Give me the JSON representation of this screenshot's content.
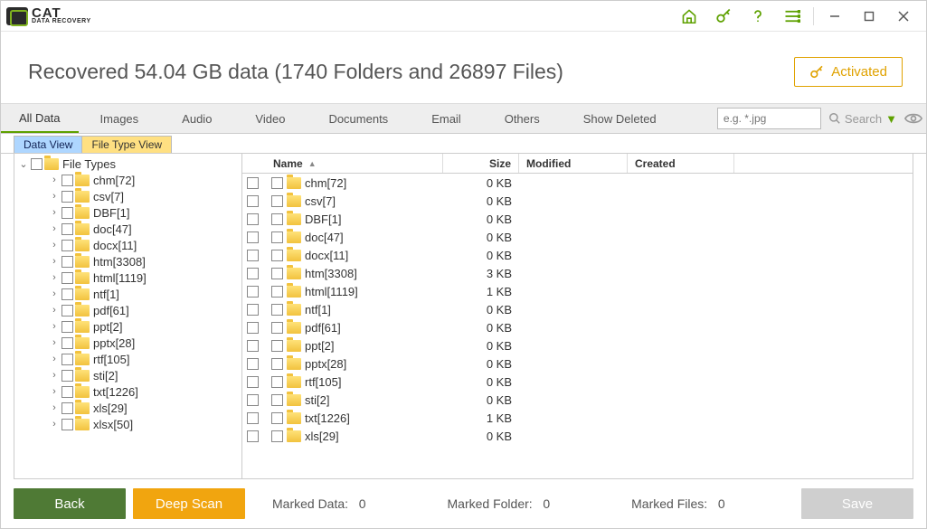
{
  "app": {
    "logo_cat": "CAT",
    "logo_dr": "DATA\nRECOVERY"
  },
  "header": {
    "title": "Recovered 54.04 GB data (1740 Folders and 26897 Files)",
    "activated": "Activated"
  },
  "toolbar": {
    "items": [
      "All Data",
      "Images",
      "Audio",
      "Video",
      "Documents",
      "Email",
      "Others",
      "Show Deleted"
    ],
    "search_placeholder": "e.g. *.jpg",
    "search_label": "Search"
  },
  "view_tabs": {
    "data_view": "Data View",
    "file_type_view": "File Type View"
  },
  "tree": {
    "root": "File Types",
    "items": [
      "chm[72]",
      "csv[7]",
      "DBF[1]",
      "doc[47]",
      "docx[11]",
      "htm[3308]",
      "html[1119]",
      "ntf[1]",
      "pdf[61]",
      "ppt[2]",
      "pptx[28]",
      "rtf[105]",
      "sti[2]",
      "txt[1226]",
      "xls[29]",
      "xlsx[50]"
    ]
  },
  "list": {
    "headers": {
      "name": "Name",
      "size": "Size",
      "modified": "Modified",
      "created": "Created"
    },
    "rows": [
      {
        "name": "chm[72]",
        "size": "0 KB"
      },
      {
        "name": "csv[7]",
        "size": "0 KB"
      },
      {
        "name": "DBF[1]",
        "size": "0 KB"
      },
      {
        "name": "doc[47]",
        "size": "0 KB"
      },
      {
        "name": "docx[11]",
        "size": "0 KB"
      },
      {
        "name": "htm[3308]",
        "size": "3 KB"
      },
      {
        "name": "html[1119]",
        "size": "1 KB"
      },
      {
        "name": "ntf[1]",
        "size": "0 KB"
      },
      {
        "name": "pdf[61]",
        "size": "0 KB"
      },
      {
        "name": "ppt[2]",
        "size": "0 KB"
      },
      {
        "name": "pptx[28]",
        "size": "0 KB"
      },
      {
        "name": "rtf[105]",
        "size": "0 KB"
      },
      {
        "name": "sti[2]",
        "size": "0 KB"
      },
      {
        "name": "txt[1226]",
        "size": "1 KB"
      },
      {
        "name": "xls[29]",
        "size": "0 KB"
      }
    ]
  },
  "footer": {
    "back": "Back",
    "deep_scan": "Deep Scan",
    "marked_data_label": "Marked Data:",
    "marked_data_value": "0",
    "marked_folder_label": "Marked Folder:",
    "marked_folder_value": "0",
    "marked_files_label": "Marked Files:",
    "marked_files_value": "0",
    "save": "Save"
  }
}
